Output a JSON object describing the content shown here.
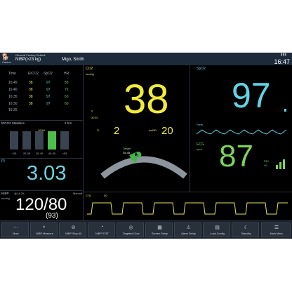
{
  "header": {
    "profile": "General Factory Default",
    "category": "Canine",
    "patient_label": "NIBP(>23 kg)",
    "patient_name": "Migo, Smith",
    "clock": "16:47"
  },
  "trend_table": {
    "headers": [
      "Time",
      "EtCO2",
      "SpO2",
      "HR"
    ],
    "rows": [
      {
        "time": "16:45",
        "etco2": "38",
        "spo2": "97",
        "hr": "83"
      },
      {
        "time": "16:40",
        "etco2": "38",
        "spo2": "97",
        "hr": "72"
      },
      {
        "time": "16:35",
        "etco2": "38",
        "spo2": "97",
        "hr": "63"
      },
      {
        "time": "16:30",
        "etco2": "38",
        "spo2": "97",
        "hr": "60"
      },
      {
        "time": "16:25",
        "etco2": "",
        "spo2": "",
        "hr": ""
      }
    ]
  },
  "etco2_stats": {
    "title": "EtCO2 Statistics",
    "range": "2 hrs",
    "peak_label": "100%",
    "bins": [
      "0",
      "0%",
      "0%",
      "0%",
      "0%"
    ],
    "bin_labels": [
      "<25",
      "25-35",
      "35-45",
      "45-55",
      ">55"
    ],
    "bin_values": [
      0,
      0,
      0,
      100,
      0
    ]
  },
  "pi": {
    "label": "PI",
    "value": "3.03"
  },
  "nibp": {
    "label": "NIBP",
    "time": "@14:29",
    "unit": "mmHg",
    "sub": "Manual",
    "value": "120/80",
    "mean": "(93)"
  },
  "co2": {
    "label": "CO2",
    "unit": "mmHg",
    "value": "38",
    "fi_label": "Fi",
    "fi_value": "2",
    "awrr_label": "awRR",
    "awrr_value": "20",
    "side_a": "o",
    "side_b": "30 Et",
    "target_label": "Target",
    "target_range": "35-45",
    "wave_label": "CO2",
    "wave_scale": "50"
  },
  "spo2": {
    "label": "SpO2",
    "value": "97",
    "pleth": "Pleth"
  },
  "ecg": {
    "label": "ECG",
    "unit": "bpm",
    "value": "87",
    "small1": "PDI",
    "small2": "40"
  },
  "buttons": [
    {
      "label": "More",
      "icon": "⋯"
    },
    {
      "label": "NIBP Measure",
      "icon": "◐"
    },
    {
      "label": "NIBP Stop All",
      "icon": "⊘"
    },
    {
      "label": "NIBP STAT",
      "icon": "◔"
    },
    {
      "label": "Targeted Goal",
      "icon": "◎"
    },
    {
      "label": "Screen Setup",
      "icon": "▦"
    },
    {
      "label": "Alarm Setup",
      "icon": "⚠"
    },
    {
      "label": "Load Config",
      "icon": "▤"
    },
    {
      "label": "Standby",
      "icon": "☾"
    },
    {
      "label": "Main Menu",
      "icon": "☰"
    }
  ],
  "colors": {
    "etco2": "#f2ea3a",
    "spo2": "#5fd4e6",
    "ecg": "#7fd35a",
    "pi": "#6fd1e2",
    "nibp": "#ffffff"
  }
}
